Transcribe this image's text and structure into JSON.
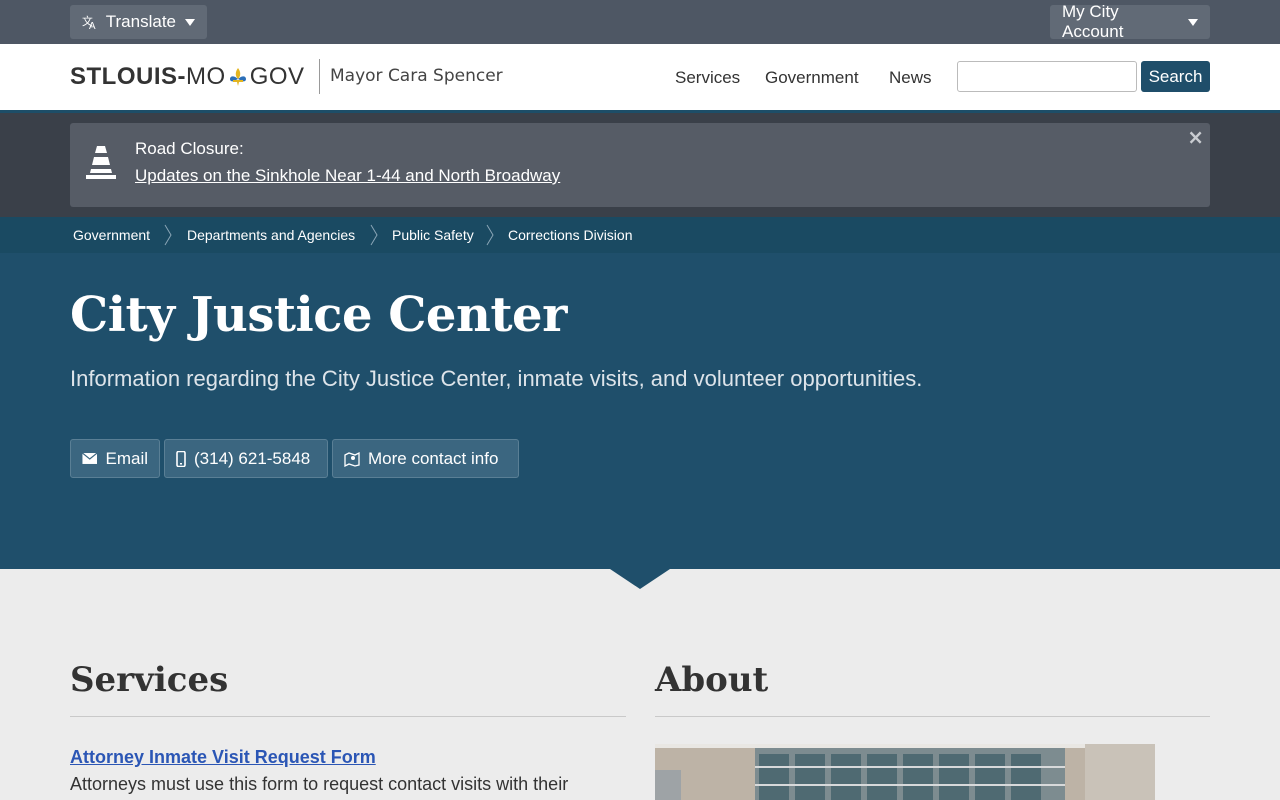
{
  "topbar": {
    "translate_label": "Translate",
    "account_label": "My City Account"
  },
  "header": {
    "logo": {
      "part1": "STLOUIS",
      "dash": "-",
      "part2": "MO",
      "part3": "GOV"
    },
    "mayor": "Mayor Cara Spencer",
    "nav": [
      "Services",
      "Government",
      "News"
    ],
    "search": {
      "placeholder": "",
      "button_label": "Search"
    }
  },
  "alert": {
    "title": "Road Closure:",
    "link_text": "Updates on the Sinkhole Near 1-44 and North Broadway",
    "close": "×"
  },
  "breadcrumb": [
    "Government",
    "Departments and Agencies",
    "Public Safety",
    "Corrections Division"
  ],
  "hero": {
    "title": "City Justice Center",
    "subtitle": "Information regarding the City Justice Center, inmate visits, and volunteer opportunities.",
    "buttons": {
      "email": "Email",
      "phone": "(314) 621-5848",
      "more": "More contact info"
    }
  },
  "services": {
    "heading": "Services",
    "items": [
      {
        "title": "Attorney Inmate Visit Request Form",
        "desc": "Attorneys must use this form to request contact visits with their"
      }
    ]
  },
  "about": {
    "heading": "About"
  },
  "colors": {
    "topbar": "#4e5764",
    "brand_blue": "#1f4f6b",
    "breadcrumb": "#1a4a62",
    "link": "#2b56b5",
    "alert_bg": "#565c66"
  }
}
